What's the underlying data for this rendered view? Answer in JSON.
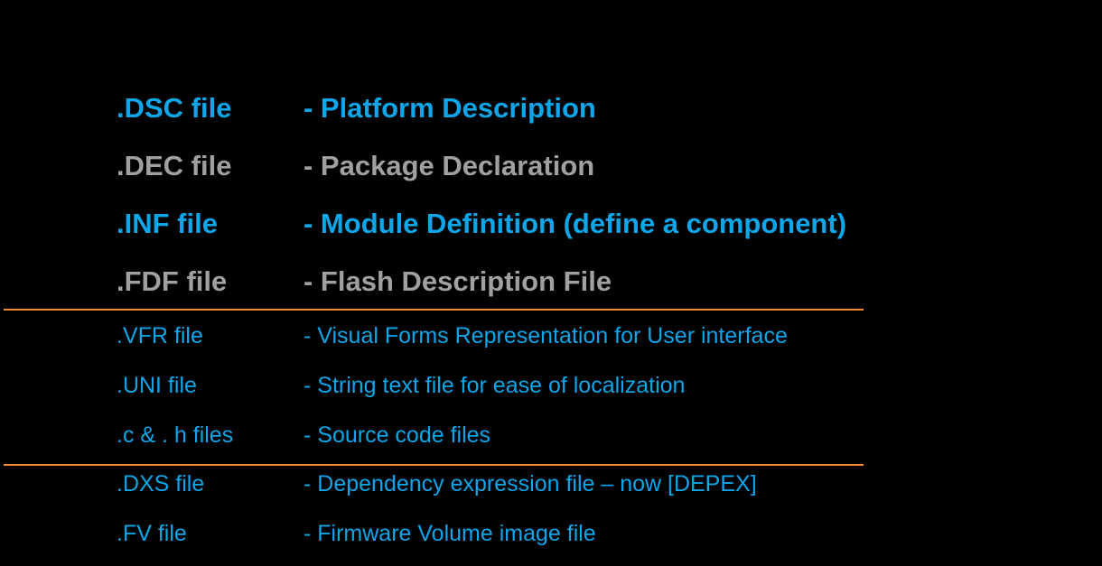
{
  "slide": {
    "primary_rows": [
      {
        "ext": ".DSC file",
        "desc": "- Platform Description"
      },
      {
        "ext": ".DEC file",
        "desc": "- Package Declaration"
      },
      {
        "ext": ".INF file",
        "desc": "- Module Definition (define a component)"
      },
      {
        "ext": ".FDF file",
        "desc": "- Flash Description File"
      }
    ],
    "secondary_rows": [
      {
        "ext": ".VFR file",
        "desc": "- Visual Forms Representation for User interface"
      },
      {
        "ext": ".UNI file",
        "desc": "- String text file for ease of localization"
      },
      {
        "ext": ".c  & . h files",
        "desc": "- Source code files"
      }
    ],
    "output_rows": [
      {
        "ext": ".DXS file",
        "desc": "- Dependency expression file – now [DEPEX]"
      },
      {
        "ext": ".FV file",
        "desc": "- Firmware Volume image file"
      }
    ]
  },
  "colors": {
    "background": "#000000",
    "accent_blue": "#0ea5e9",
    "accent_grey": "#a0a0a0",
    "divider_orange": "#f08a2c"
  }
}
